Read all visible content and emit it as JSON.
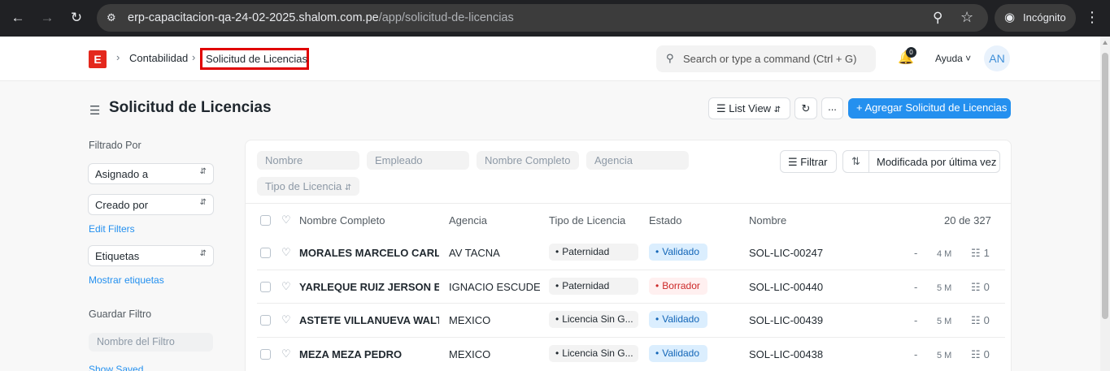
{
  "browser": {
    "url_host": "erp-capacitacion-qa-24-02-2025.shalom.com.pe",
    "url_path": "/app/solicitud-de-licencias",
    "profile_label": "Incógnito"
  },
  "navbar": {
    "logo_letter": "E",
    "breadcrumbs": [
      "Contabilidad",
      "Solicitud de Licencias"
    ],
    "search_placeholder": "Search or type a command (Ctrl + G)",
    "notification_count": "0",
    "help_label": "Ayuda",
    "avatar_initials": "AN"
  },
  "page": {
    "title": "Solicitud de Licencias",
    "list_view_label": "List View",
    "more_label": "...",
    "primary_button": "+ Agregar Solicitud de Licencias"
  },
  "sidebar": {
    "filtered_by": "Filtrado Por",
    "assigned_to": "Asignado a",
    "created_by": "Creado por",
    "edit_filters": "Edit Filters",
    "tags": "Etiquetas",
    "show_tags": "Mostrar etiquetas",
    "save_filter": "Guardar Filtro",
    "filter_name_placeholder": "Nombre del Filtro",
    "show_saved": "Show Saved"
  },
  "filters": {
    "fields": [
      "Nombre",
      "Empleado",
      "Nombre Completo",
      "Agencia",
      "Tipo de Licencia"
    ],
    "filter_button": "Filtrar",
    "sort_label": "Modificada por última vez"
  },
  "table": {
    "columns": [
      "Nombre Completo",
      "Agencia",
      "Tipo de Licencia",
      "Estado",
      "Nombre"
    ],
    "count": "20 de 327",
    "rows": [
      {
        "name": "MORALES MARCELO CARLOS",
        "agency": "AV TACNA",
        "type": "Paternidad",
        "status": "Validado",
        "status_kind": "blue",
        "id": "SOL-LIC-00247",
        "dash": "-",
        "age": "4 M",
        "comments": "1"
      },
      {
        "name": "YARLEQUE RUIZ JERSON ELIEZ",
        "agency": "IGNACIO ESCUDE...",
        "type": "Paternidad",
        "status": "Borrador",
        "status_kind": "red",
        "id": "SOL-LIC-00440",
        "dash": "-",
        "age": "5 M",
        "comments": "0"
      },
      {
        "name": "ASTETE VILLANUEVA WALTER",
        "agency": "MEXICO",
        "type": "Licencia Sin G...",
        "status": "Validado",
        "status_kind": "blue",
        "id": "SOL-LIC-00439",
        "dash": "-",
        "age": "5 M",
        "comments": "0"
      },
      {
        "name": "MEZA MEZA PEDRO",
        "agency": "MEXICO",
        "type": "Licencia Sin G...",
        "status": "Validado",
        "status_kind": "blue",
        "id": "SOL-LIC-00438",
        "dash": "-",
        "age": "5 M",
        "comments": "0"
      }
    ]
  },
  "colors": {
    "brand": "#e4281d",
    "primary": "#2490ef",
    "highlight_border": "#e00000"
  }
}
